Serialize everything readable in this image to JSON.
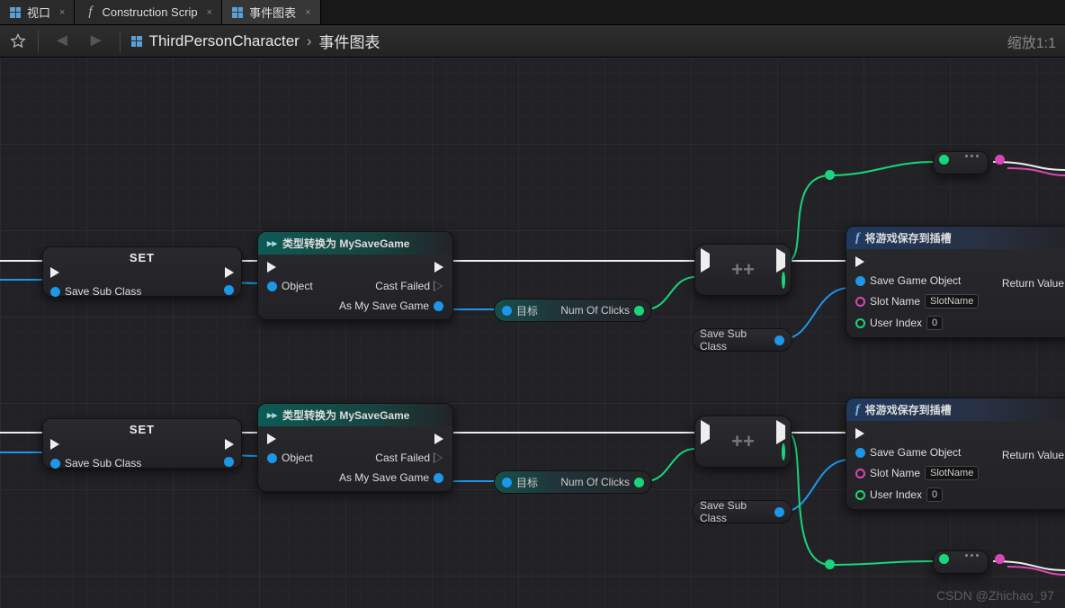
{
  "tabs": [
    {
      "label": "视口"
    },
    {
      "label": "Construction Scrip"
    },
    {
      "label": "事件图表"
    }
  ],
  "breadcrumb": {
    "asset": "ThirdPersonCharacter",
    "graph": "事件图表"
  },
  "zoom_label": "缩放1:1",
  "nodes": {
    "set": {
      "title": "SET",
      "pin": "Save Sub Class"
    },
    "cast": {
      "title": "类型转换为 MySaveGame",
      "pinObject": "Object",
      "pinCastFailed": "Cast Failed",
      "pinAs": "As My Save Game"
    },
    "getClicks": {
      "target": "目标",
      "out": "Num Of Clicks"
    },
    "saveSubPill": {
      "label": "Save Sub Class"
    },
    "saveFn": {
      "title": "将游戏保存到插槽",
      "pinObj": "Save Game Object",
      "pinSlot": "Slot Name",
      "slotValue": "SlotName",
      "pinIdx": "User Index",
      "idxValue": "0",
      "pinReturn": "Return Value"
    }
  },
  "watermark": "CSDN @Zhichao_97"
}
